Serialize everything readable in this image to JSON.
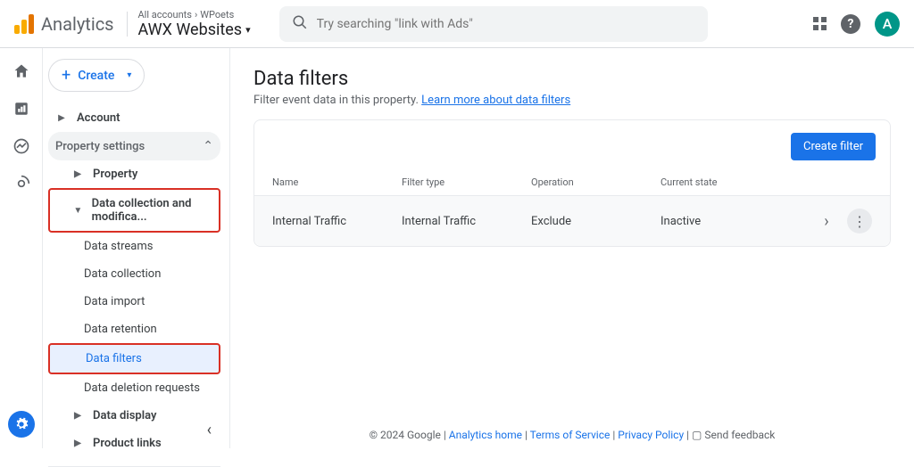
{
  "header": {
    "brand": "Analytics",
    "breadcrumb_root": "All accounts",
    "breadcrumb_account": "WPoets",
    "property": "AWX Websites",
    "search_placeholder": "Try searching \"link with Ads\"",
    "avatar_initial": "A"
  },
  "sidebar": {
    "create": "Create",
    "account": "Account",
    "property_settings": "Property settings",
    "property": "Property",
    "data_collection_mod": "Data collection and modifica...",
    "items": {
      "data_streams": "Data streams",
      "data_collection": "Data collection",
      "data_import": "Data import",
      "data_retention": "Data retention",
      "data_filters": "Data filters",
      "data_deletion": "Data deletion requests"
    },
    "data_display": "Data display",
    "product_links": "Product links"
  },
  "main": {
    "title": "Data filters",
    "desc_prefix": "Filter event data in this property. ",
    "desc_link": "Learn more about data filters",
    "create_filter": "Create filter",
    "columns": {
      "name": "Name",
      "type": "Filter type",
      "op": "Operation",
      "state": "Current state"
    },
    "row": {
      "name": "Internal Traffic",
      "type": "Internal Traffic",
      "op": "Exclude",
      "state": "Inactive"
    }
  },
  "footer": {
    "copyright": "© 2024 Google",
    "analytics_home": "Analytics home",
    "tos": "Terms of Service",
    "privacy": "Privacy Policy",
    "feedback": "Send feedback"
  }
}
